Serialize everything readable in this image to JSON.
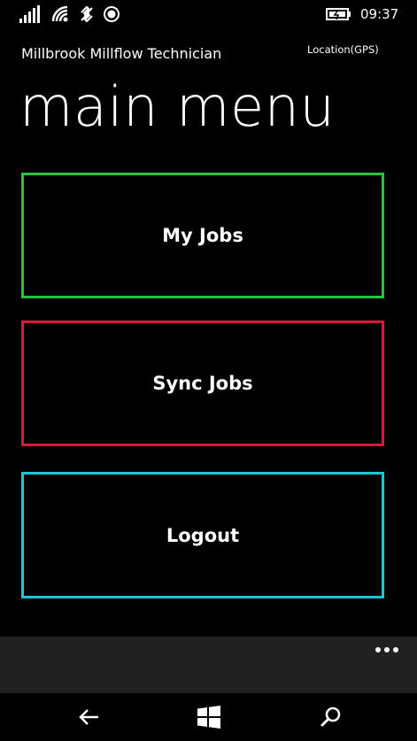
{
  "status_bar": {
    "time": "09:37",
    "icons": [
      "signal-icon",
      "wifi-icon",
      "data-sense-icon",
      "location-icon",
      "battery-charging-icon"
    ]
  },
  "header": {
    "app_title": "Millbrook Millflow Technician",
    "location_label": "Location(GPS)",
    "page_title": "main menu"
  },
  "menu": {
    "items": [
      {
        "label": "My Jobs",
        "color": "#27c43f"
      },
      {
        "label": "Sync Jobs",
        "color": "#d8173b"
      },
      {
        "label": "Logout",
        "color": "#1ec6d2"
      }
    ]
  },
  "app_bar": {
    "more_icon": "ellipsis-icon"
  },
  "nav_bar": {
    "icons": [
      "back-icon",
      "windows-start-icon",
      "search-icon"
    ]
  },
  "colors": {
    "background": "#000000",
    "app_bar_background": "#212121",
    "text": "#ffffff"
  }
}
